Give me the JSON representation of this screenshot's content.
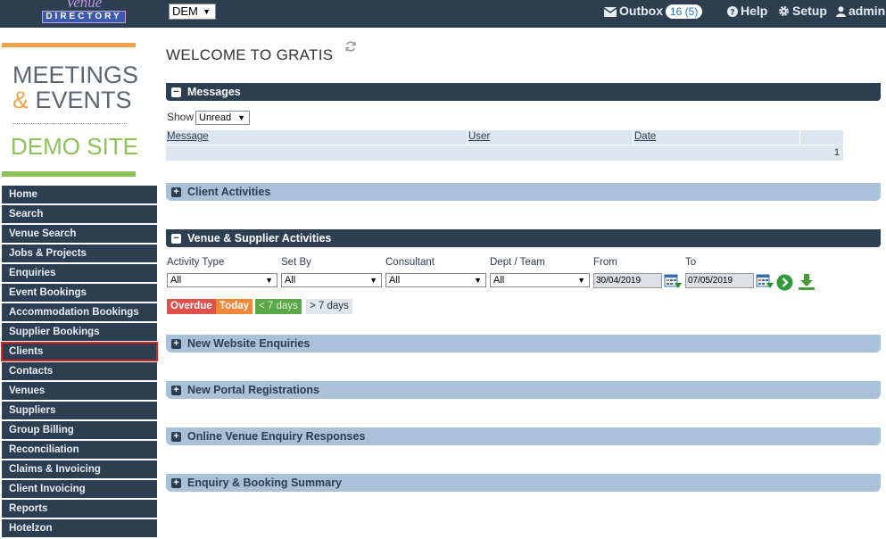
{
  "header": {
    "logo_top": "Venue",
    "logo_bottom": "DIRECTORY",
    "company_select": "DEM",
    "outbox_label": "Outbox",
    "outbox_count": "16 (5)",
    "help_label": "Help",
    "setup_label": "Setup",
    "user_label": "admin"
  },
  "brand": {
    "line1": "MEETINGS",
    "line2_amp": "&",
    "line2_rest": " EVENTS",
    "line3": "DEMO SITE"
  },
  "sidebar": {
    "items": [
      {
        "label": "Home"
      },
      {
        "label": "Search"
      },
      {
        "label": "Venue Search"
      },
      {
        "label": "Jobs & Projects"
      },
      {
        "label": "Enquiries"
      },
      {
        "label": "Event Bookings"
      },
      {
        "label": "Accommodation Bookings"
      },
      {
        "label": "Supplier Bookings"
      },
      {
        "label": "Clients"
      },
      {
        "label": "Contacts"
      },
      {
        "label": "Venues"
      },
      {
        "label": "Suppliers"
      },
      {
        "label": "Group Billing"
      },
      {
        "label": "Reconciliation"
      },
      {
        "label": "Claims & Invoicing"
      },
      {
        "label": "Client Invoicing"
      },
      {
        "label": "Reports"
      },
      {
        "label": "Hotelzon"
      }
    ],
    "active": "Clients"
  },
  "main": {
    "title": "WELCOME TO GRATIS",
    "messages": {
      "heading": "Messages",
      "show_label": "Show",
      "show_value": "Unread",
      "columns": [
        "Message",
        "User",
        "Date"
      ],
      "page": "1"
    },
    "client_activities": "Client Activities",
    "venue_supplier": {
      "heading": "Venue & Supplier Activities",
      "labels": {
        "activity_type": "Activity Type",
        "set_by": "Set By",
        "consultant": "Consultant",
        "dept_team": "Dept / Team",
        "from": "From",
        "to": "To"
      },
      "values": {
        "activity_type": "All",
        "set_by": "All",
        "consultant": "All",
        "dept_team": "All",
        "from": "30/04/2019",
        "to": "07/05/2019"
      },
      "legend": {
        "overdue": "Overdue",
        "today": "Today",
        "lt7": "< 7 days",
        "gt7": "> 7 days"
      }
    },
    "sections": [
      "New Website Enquiries",
      "New Portal Registrations",
      "Online Venue Enquiry Responses",
      "Enquiry & Booking Summary"
    ]
  },
  "colors": {
    "navy": "#2c3e50",
    "light_panel": "#a9c1d9",
    "orange": "#f0a34a",
    "green": "#8dc25a",
    "overdue": "#e0504a",
    "today": "#f0883a",
    "lt7": "#5aa84a",
    "gt7": "#dfe6ec"
  }
}
